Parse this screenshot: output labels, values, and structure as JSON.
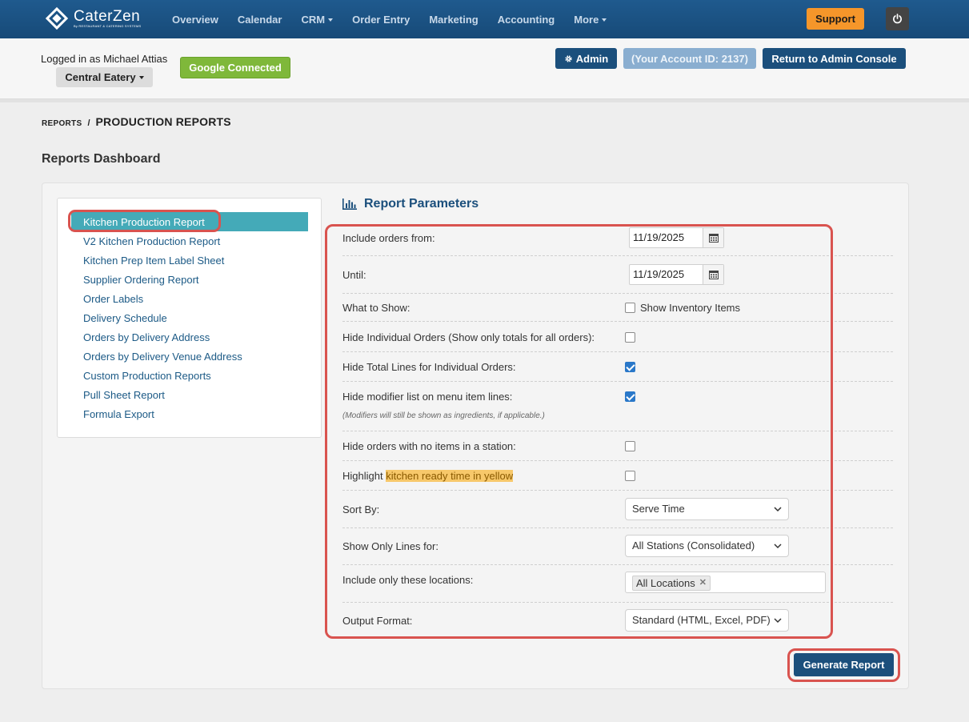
{
  "brand": {
    "name": "CaterZen",
    "tagline": "By RESTAURANT & CATERING SYSTEMS"
  },
  "nav": {
    "items": [
      {
        "label": "Overview",
        "dropdown": false
      },
      {
        "label": "Calendar",
        "dropdown": false
      },
      {
        "label": "CRM",
        "dropdown": true
      },
      {
        "label": "Order Entry",
        "dropdown": false
      },
      {
        "label": "Marketing",
        "dropdown": false
      },
      {
        "label": "Accounting",
        "dropdown": false
      },
      {
        "label": "More",
        "dropdown": true
      }
    ],
    "support_label": "Support",
    "power_icon": "power-icon"
  },
  "account": {
    "logged_in_text": "Logged in as Michael Attias",
    "eatery_label": "Central Eatery",
    "google_label": "Google Connected",
    "admin_label": "Admin",
    "account_id_label": "(Your Account ID: 2137)",
    "return_label": "Return to Admin Console"
  },
  "breadcrumb": {
    "root": "REPORTS",
    "separator": "/",
    "current": "PRODUCTION REPORTS"
  },
  "page_title": "Reports Dashboard",
  "sidebar": {
    "items": [
      "Kitchen Production Report",
      "V2 Kitchen Production Report",
      "Kitchen Prep Item Label Sheet",
      "Supplier Ordering Report",
      "Order Labels",
      "Delivery Schedule",
      "Orders by Delivery Address",
      "Orders by Delivery Venue Address",
      "Custom Production Reports",
      "Pull Sheet Report",
      "Formula Export"
    ],
    "active_index": 0
  },
  "params": {
    "title": "Report Parameters",
    "include_from": {
      "label": "Include orders from:",
      "value": "11/19/2025"
    },
    "until": {
      "label": "Until:",
      "value": "11/19/2025"
    },
    "what_to_show": {
      "label": "What to Show:",
      "option_label": "Show Inventory Items",
      "checked": false
    },
    "hide_individual": {
      "label": "Hide Individual Orders (Show only totals for all orders):",
      "checked": false
    },
    "hide_total_lines": {
      "label": "Hide Total Lines for Individual Orders:",
      "checked": true
    },
    "hide_modifier": {
      "label": "Hide modifier list on menu item lines:",
      "note": "(Modifiers will still be shown as ingredients, if applicable.)",
      "checked": true
    },
    "hide_no_items": {
      "label": "Hide orders with no items in a station:",
      "checked": false
    },
    "highlight": {
      "label_prefix": "Highlight ",
      "label_highlight": "kitchen ready time in yellow",
      "checked": false
    },
    "sort_by": {
      "label": "Sort By:",
      "value": "Serve Time"
    },
    "show_only_lines": {
      "label": "Show Only Lines for:",
      "value": "All Stations (Consolidated)"
    },
    "locations": {
      "label": "Include only these locations:",
      "tag": "All Locations"
    },
    "output_format": {
      "label": "Output Format:",
      "value": "Standard (HTML, Excel, PDF)"
    }
  },
  "generate_label": "Generate Report",
  "colors": {
    "nav_bg": "#1f5a8e",
    "primary_button": "#1b4f7c",
    "support": "#f5962a",
    "google": "#7fb83a",
    "active_item": "#44aab8",
    "annotation": "#d9534f",
    "highlight_yellow": "#f7c86a"
  }
}
